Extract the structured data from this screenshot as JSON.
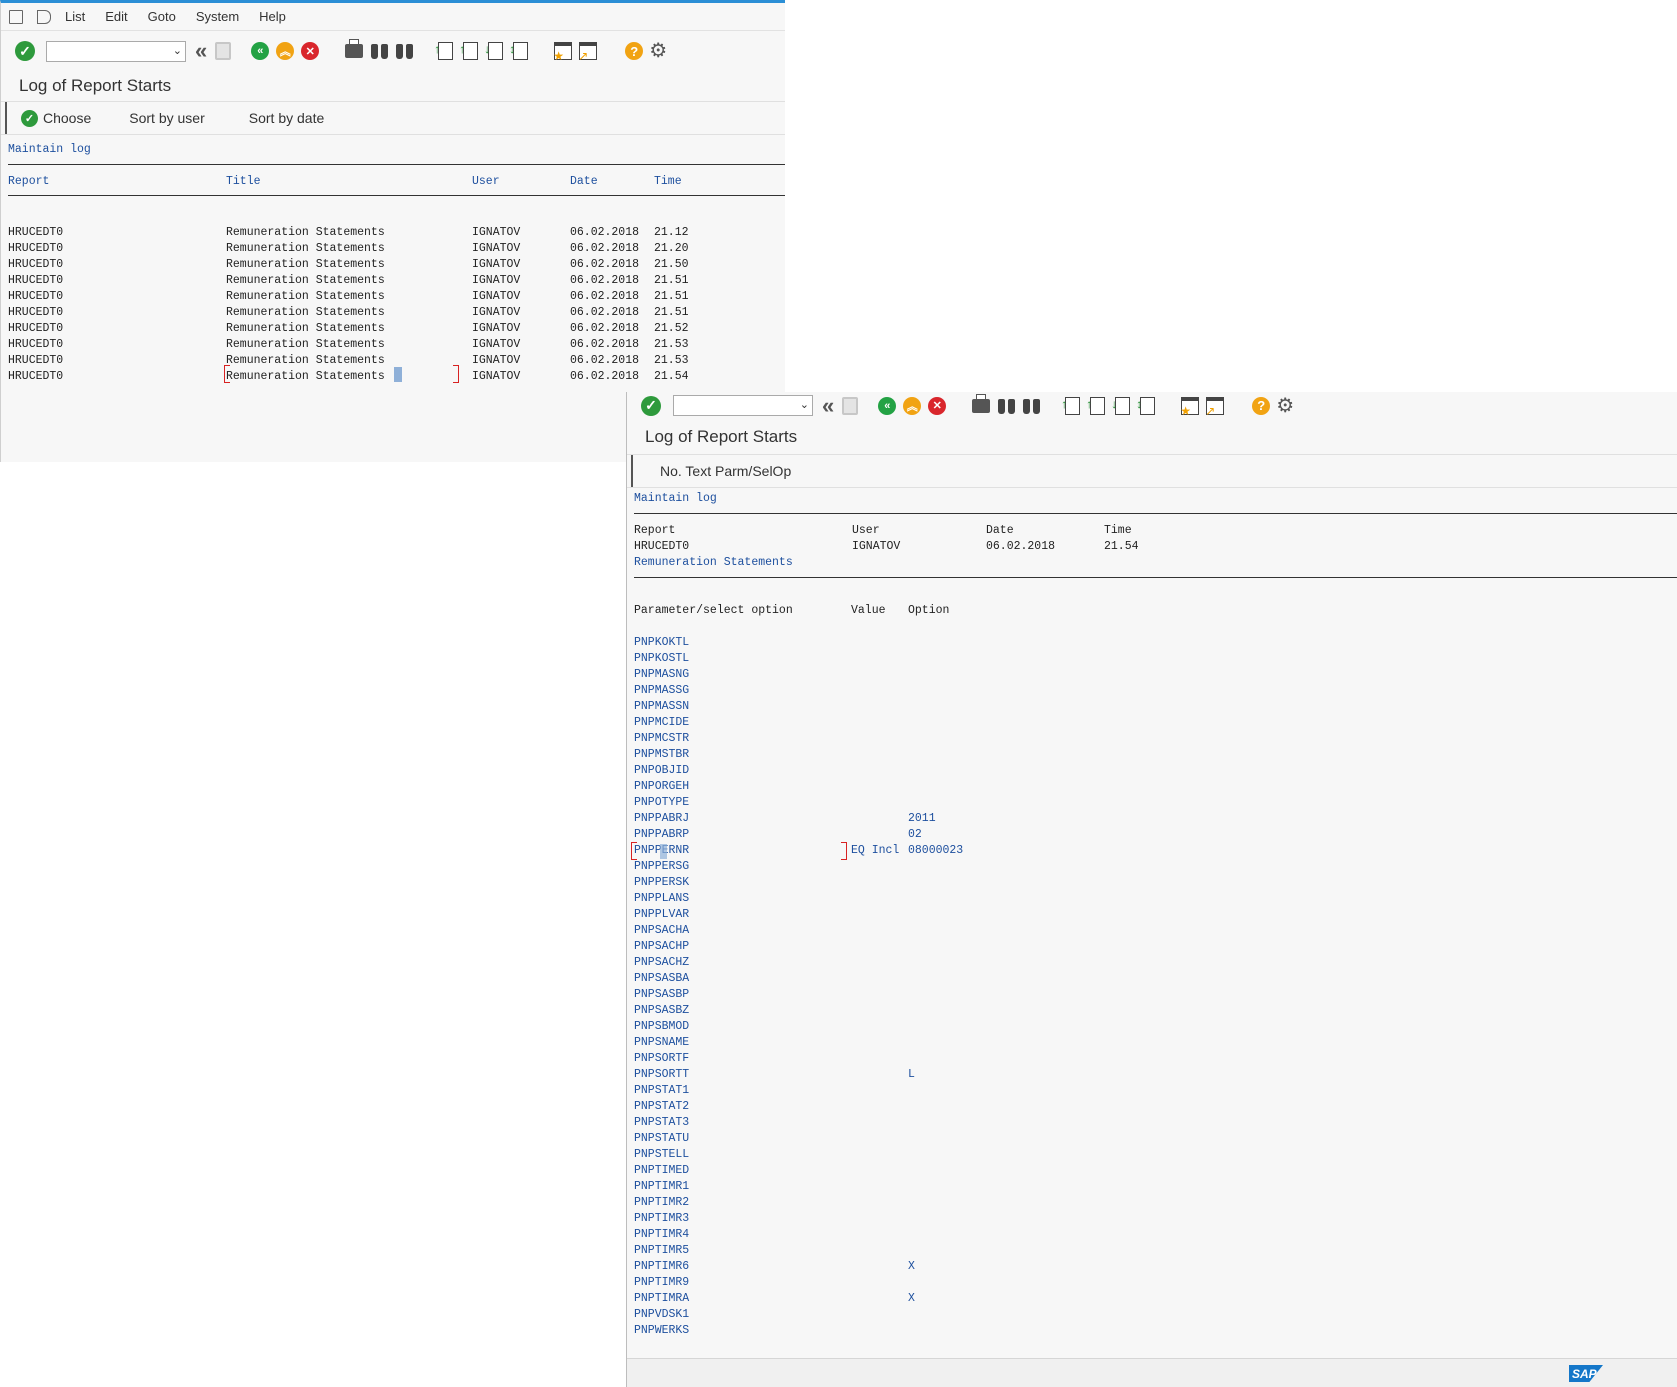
{
  "menu": {
    "items": [
      "List",
      "Edit",
      "Goto",
      "System",
      "Help"
    ]
  },
  "screen1": {
    "title": "Log of Report Starts",
    "buttons": {
      "choose": "Choose",
      "sort_user": "Sort by user",
      "sort_date": "Sort by date"
    },
    "list_title": "Maintain log",
    "headers": {
      "report": "Report",
      "title": "Title",
      "user": "User",
      "date": "Date",
      "time": "Time"
    },
    "rows": [
      {
        "report": "HRUCEDT0",
        "title": "Remuneration Statements",
        "user": "IGNATOV",
        "date": "06.02.2018",
        "time": "21.12"
      },
      {
        "report": "HRUCEDT0",
        "title": "Remuneration Statements",
        "user": "IGNATOV",
        "date": "06.02.2018",
        "time": "21.20"
      },
      {
        "report": "HRUCEDT0",
        "title": "Remuneration Statements",
        "user": "IGNATOV",
        "date": "06.02.2018",
        "time": "21.50"
      },
      {
        "report": "HRUCEDT0",
        "title": "Remuneration Statements",
        "user": "IGNATOV",
        "date": "06.02.2018",
        "time": "21.51"
      },
      {
        "report": "HRUCEDT0",
        "title": "Remuneration Statements",
        "user": "IGNATOV",
        "date": "06.02.2018",
        "time": "21.51"
      },
      {
        "report": "HRUCEDT0",
        "title": "Remuneration Statements",
        "user": "IGNATOV",
        "date": "06.02.2018",
        "time": "21.51"
      },
      {
        "report": "HRUCEDT0",
        "title": "Remuneration Statements",
        "user": "IGNATOV",
        "date": "06.02.2018",
        "time": "21.52"
      },
      {
        "report": "HRUCEDT0",
        "title": "Remuneration Statements",
        "user": "IGNATOV",
        "date": "06.02.2018",
        "time": "21.53"
      },
      {
        "report": "HRUCEDT0",
        "title": "Remuneration Statements",
        "user": "IGNATOV",
        "date": "06.02.2018",
        "time": "21.53"
      },
      {
        "report": "HRUCEDT0",
        "title": "Remuneration Statements",
        "user": "IGNATOV",
        "date": "06.02.2018",
        "time": "21.54"
      }
    ]
  },
  "screen2": {
    "title": "Log of Report Starts",
    "appbar_label": "No.  Text Parm/SelOp",
    "list_title": "Maintain log",
    "head": {
      "report_label": "Report",
      "user_label": "User",
      "date_label": "Date",
      "time_label": "Time",
      "report": "HRUCEDT0",
      "user": "IGNATOV",
      "date": "06.02.2018",
      "time": "21.54",
      "title": "Remuneration Statements"
    },
    "param_headers": {
      "param": "Parameter/select option",
      "value": "Value",
      "option": "Option"
    },
    "params": [
      {
        "name": "PNPKOKTL",
        "value": "",
        "option": ""
      },
      {
        "name": "PNPKOSTL",
        "value": "",
        "option": ""
      },
      {
        "name": "PNPMASNG",
        "value": "",
        "option": ""
      },
      {
        "name": "PNPMASSG",
        "value": "",
        "option": ""
      },
      {
        "name": "PNPMASSN",
        "value": "",
        "option": ""
      },
      {
        "name": "PNPMCIDE",
        "value": "",
        "option": ""
      },
      {
        "name": "PNPMCSTR",
        "value": "",
        "option": ""
      },
      {
        "name": "PNPMSTBR",
        "value": "",
        "option": ""
      },
      {
        "name": "PNPOBJID",
        "value": "",
        "option": ""
      },
      {
        "name": "PNPORGEH",
        "value": "",
        "option": ""
      },
      {
        "name": "PNPOTYPE",
        "value": "",
        "option": ""
      },
      {
        "name": "PNPPABRJ",
        "value": "",
        "option": "2011"
      },
      {
        "name": "PNPPABRP",
        "value": "",
        "option": "02"
      },
      {
        "name": "PNPPERNR",
        "value": "EQ Incl",
        "option": "08000023"
      },
      {
        "name": "PNPPERSG",
        "value": "",
        "option": ""
      },
      {
        "name": "PNPPERSK",
        "value": "",
        "option": ""
      },
      {
        "name": "PNPPLANS",
        "value": "",
        "option": ""
      },
      {
        "name": "PNPPLVAR",
        "value": "",
        "option": ""
      },
      {
        "name": "PNPSACHA",
        "value": "",
        "option": ""
      },
      {
        "name": "PNPSACHP",
        "value": "",
        "option": ""
      },
      {
        "name": "PNPSACHZ",
        "value": "",
        "option": ""
      },
      {
        "name": "PNPSASBA",
        "value": "",
        "option": ""
      },
      {
        "name": "PNPSASBP",
        "value": "",
        "option": ""
      },
      {
        "name": "PNPSASBZ",
        "value": "",
        "option": ""
      },
      {
        "name": "PNPSBMOD",
        "value": "",
        "option": ""
      },
      {
        "name": "PNPSNAME",
        "value": "",
        "option": ""
      },
      {
        "name": "PNPSORTF",
        "value": "",
        "option": ""
      },
      {
        "name": "PNPSORTT",
        "value": "",
        "option": "L"
      },
      {
        "name": "PNPSTAT1",
        "value": "",
        "option": ""
      },
      {
        "name": "PNPSTAT2",
        "value": "",
        "option": ""
      },
      {
        "name": "PNPSTAT3",
        "value": "",
        "option": ""
      },
      {
        "name": "PNPSTATU",
        "value": "",
        "option": ""
      },
      {
        "name": "PNPSTELL",
        "value": "",
        "option": ""
      },
      {
        "name": "PNPTIMED",
        "value": "",
        "option": ""
      },
      {
        "name": "PNPTIMR1",
        "value": "",
        "option": ""
      },
      {
        "name": "PNPTIMR2",
        "value": "",
        "option": ""
      },
      {
        "name": "PNPTIMR3",
        "value": "",
        "option": ""
      },
      {
        "name": "PNPTIMR4",
        "value": "",
        "option": ""
      },
      {
        "name": "PNPTIMR5",
        "value": "",
        "option": ""
      },
      {
        "name": "PNPTIMR6",
        "value": "",
        "option": "X"
      },
      {
        "name": "PNPTIMR9",
        "value": "",
        "option": ""
      },
      {
        "name": "PNPTIMRA",
        "value": "",
        "option": "X"
      },
      {
        "name": "PNPVDSK1",
        "value": "",
        "option": ""
      },
      {
        "name": "PNPWERKS",
        "value": "",
        "option": ""
      }
    ],
    "brand": "SAP"
  },
  "icons": [
    "enter-icon",
    "back-icon",
    "exit-icon",
    "cancel-icon",
    "print-icon",
    "find-icon",
    "find-next-icon",
    "first-page-icon",
    "prev-page-icon",
    "next-page-icon",
    "last-page-icon",
    "new-session-icon",
    "shortcut-icon",
    "help-icon",
    "settings-icon"
  ],
  "colors": {
    "accent": "#2b8fd6",
    "list_text": "#1d4f9e",
    "ok_green": "#2e9a3c",
    "cancel_red": "#d9262c",
    "warn_orange": "#f1a313"
  }
}
